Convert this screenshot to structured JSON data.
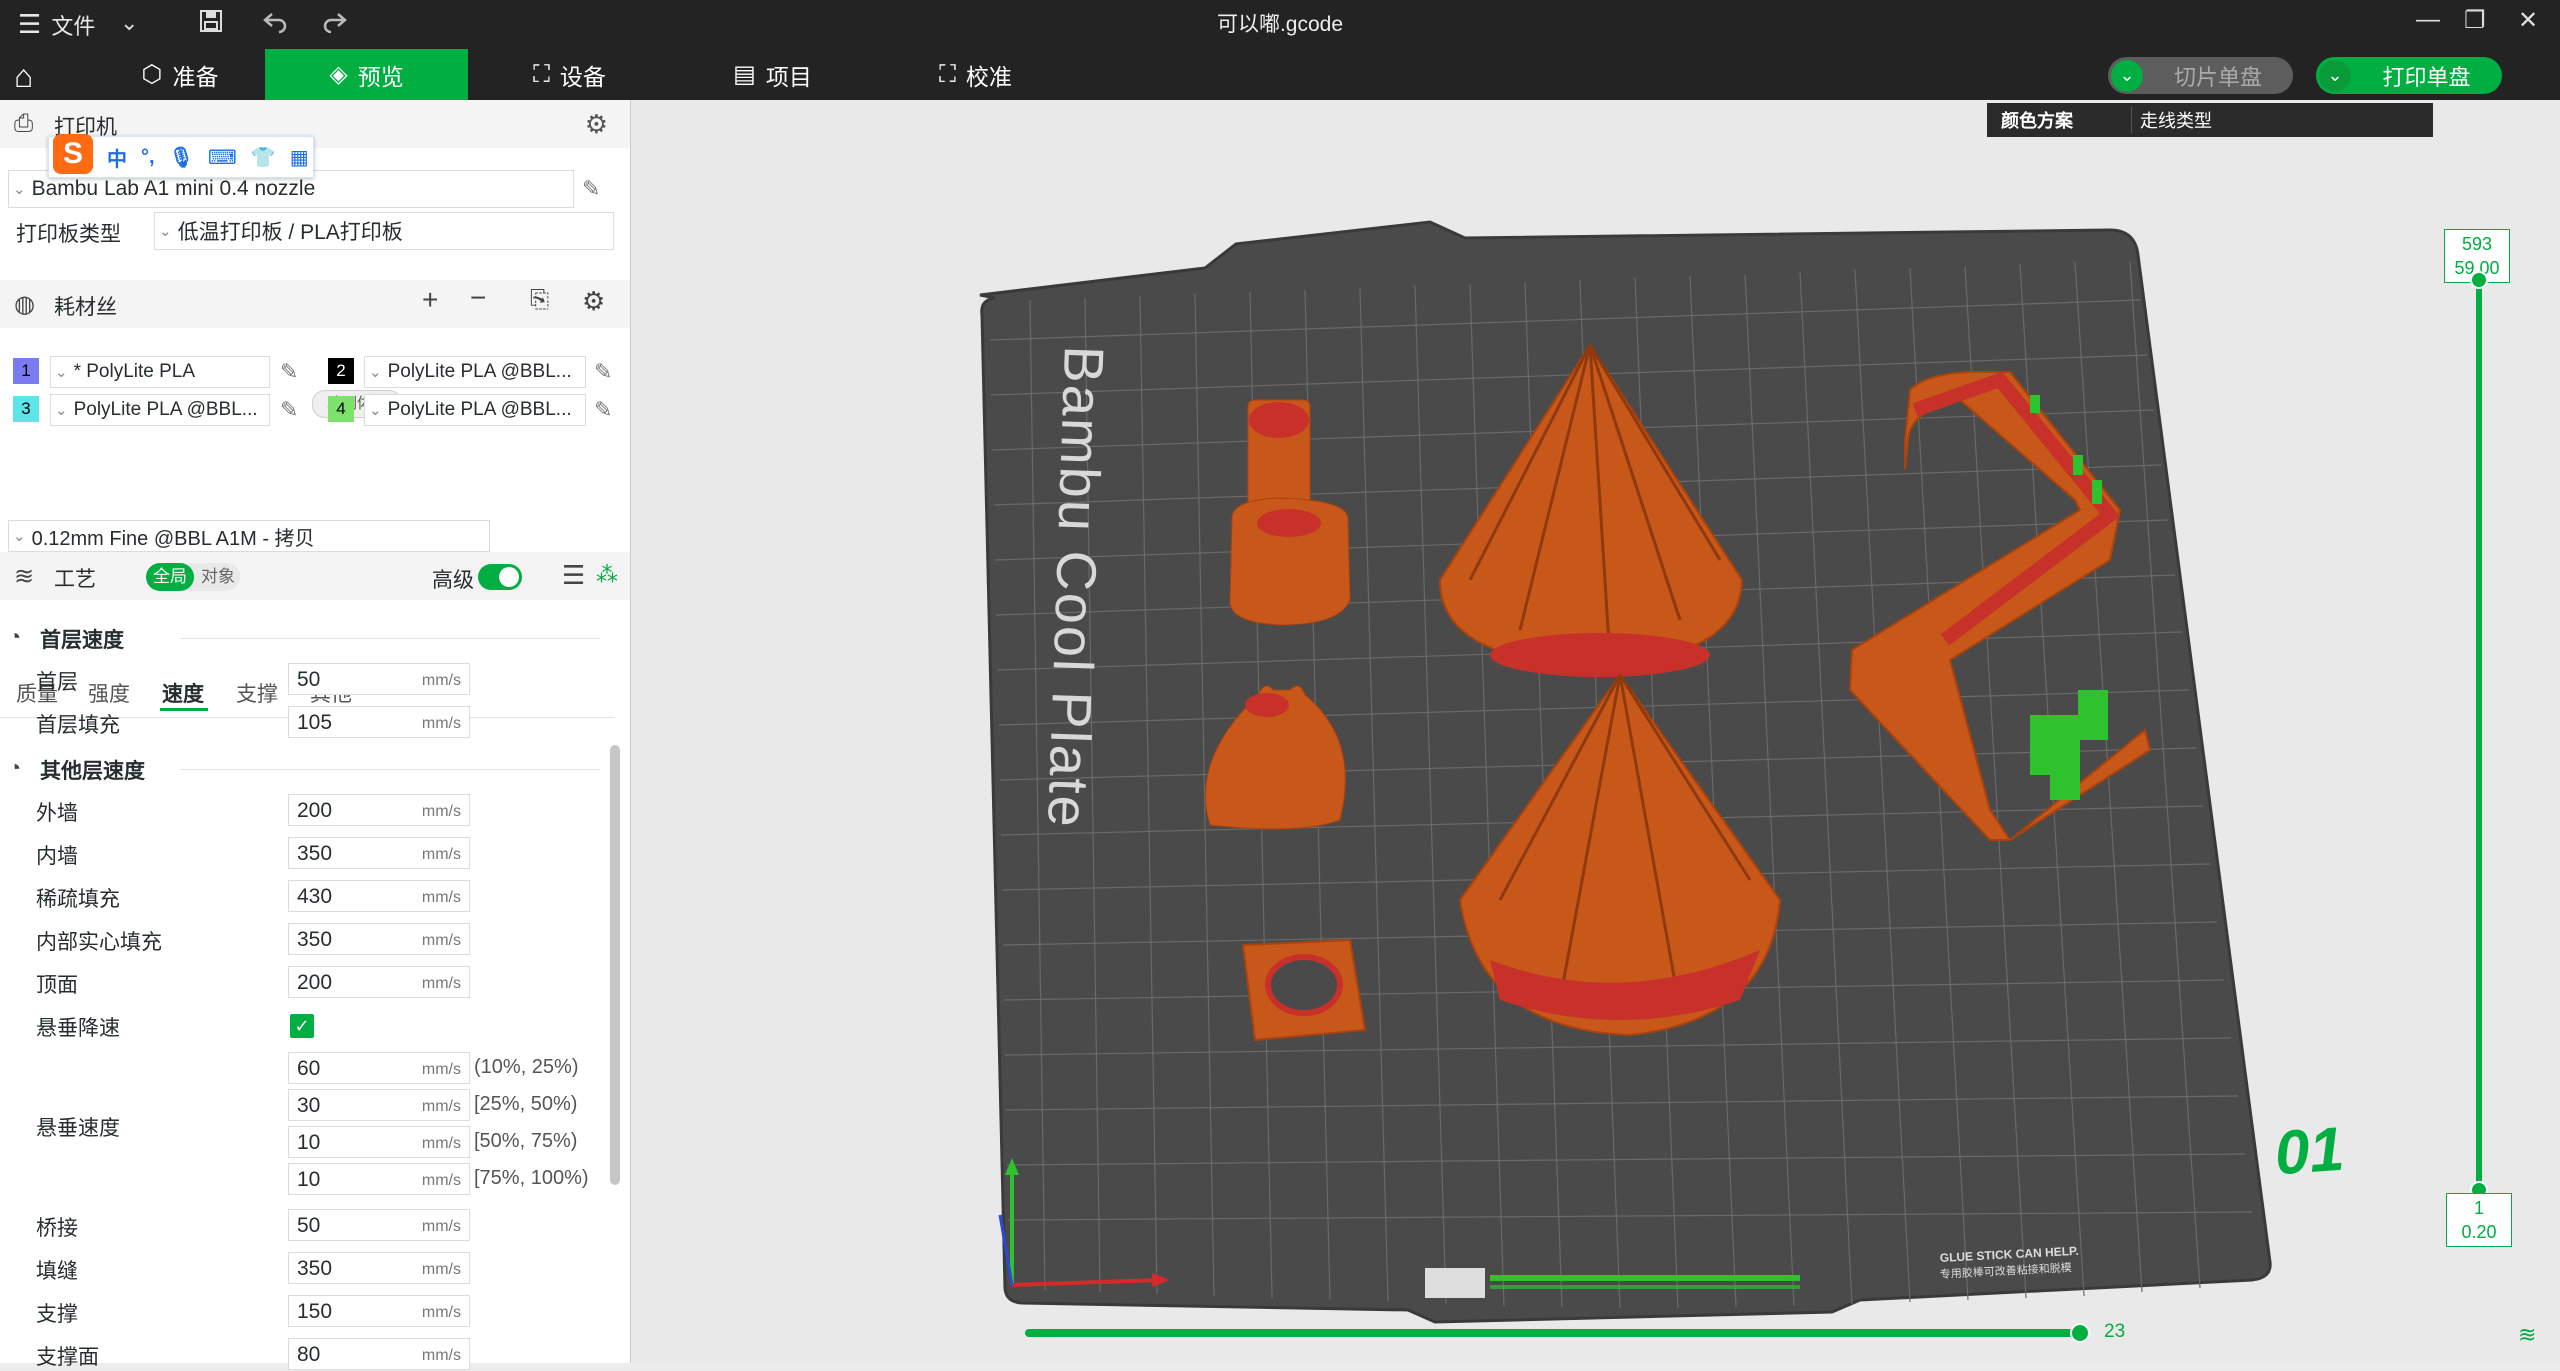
{
  "titlebar": {
    "file_menu": "文件",
    "title": "可以嘟.gcode",
    "hamburger_icon": "menu-icon",
    "save_icon": "save-icon",
    "undo_icon": "undo-icon",
    "redo_icon": "redo-icon"
  },
  "tabs": [
    {
      "label": "准备",
      "icon": "cube-icon"
    },
    {
      "label": "预览",
      "icon": "layers-icon"
    },
    {
      "label": "设备",
      "icon": "device-icon"
    },
    {
      "label": "项目",
      "icon": "project-icon"
    },
    {
      "label": "校准",
      "icon": "calibrate-icon"
    }
  ],
  "actions": {
    "slice_label": "切片单盘",
    "print_label": "打印单盘"
  },
  "ime": {
    "logo": "S",
    "lang": "中"
  },
  "printer": {
    "section_title": "打印机",
    "model": "Bambu Lab A1 mini 0.4 nozzle",
    "plate_type_label": "打印板类型",
    "plate_type_value": "低温打印板 / PLA打印板"
  },
  "filament": {
    "section_title": "耗材丝",
    "flush_label": "冲刷体积",
    "slots": [
      {
        "index": "1",
        "name": "* PolyLite PLA",
        "color": "#7b7bf0"
      },
      {
        "index": "2",
        "name": "PolyLite PLA @BBL...",
        "color": "#000000"
      },
      {
        "index": "3",
        "name": "PolyLite PLA @BBL...",
        "color": "#5ce6ea"
      },
      {
        "index": "4",
        "name": "PolyLite PLA @BBL...",
        "color": "#7be36a"
      }
    ]
  },
  "process": {
    "section_title": "工艺",
    "toggle_global": "全局",
    "toggle_object": "对象",
    "advanced_label": "高级",
    "preset": "0.12mm Fine @BBL A1M - 拷贝",
    "subtabs": [
      "质量",
      "强度",
      "速度",
      "支撑",
      "其他"
    ],
    "active_subtab": "速度"
  },
  "speed": {
    "first_layer_title": "首层速度",
    "first_layer": [
      {
        "label": "首层",
        "value": "50",
        "unit": "mm/s"
      },
      {
        "label": "首层填充",
        "value": "105",
        "unit": "mm/s"
      }
    ],
    "other_title": "其他层速度",
    "other": [
      {
        "label": "外墙",
        "value": "200",
        "unit": "mm/s"
      },
      {
        "label": "内墙",
        "value": "350",
        "unit": "mm/s"
      },
      {
        "label": "稀疏填充",
        "value": "430",
        "unit": "mm/s"
      },
      {
        "label": "内部实心填充",
        "value": "350",
        "unit": "mm/s"
      },
      {
        "label": "顶面",
        "value": "200",
        "unit": "mm/s"
      }
    ],
    "overhang_slowdown_label": "悬垂降速",
    "overhang_speed_label": "悬垂速度",
    "overhang": [
      {
        "value": "60",
        "unit": "mm/s",
        "range": "(10%, 25%)"
      },
      {
        "value": "30",
        "unit": "mm/s",
        "range": "[25%, 50%)"
      },
      {
        "value": "10",
        "unit": "mm/s",
        "range": "[50%, 75%)"
      },
      {
        "value": "10",
        "unit": "mm/s",
        "range": "[75%, 100%)"
      }
    ],
    "more": [
      {
        "label": "桥接",
        "value": "50",
        "unit": "mm/s"
      },
      {
        "label": "填缝",
        "value": "350",
        "unit": "mm/s"
      },
      {
        "label": "支撑",
        "value": "150",
        "unit": "mm/s"
      },
      {
        "label": "支撑面",
        "value": "80",
        "unit": "mm/s"
      }
    ]
  },
  "viewport": {
    "legend_label": "颜色方案",
    "legend_value": "走线类型",
    "plate_text": "Bambu Cool Plate",
    "plate_number": "01",
    "glue_line1": "GLUE STICK CAN HELP.",
    "glue_line2": "专用胶棒可改善粘接和脱模",
    "top_layer": "593",
    "top_height": "59.00",
    "bottom_layer": "1",
    "bottom_height": "0.20",
    "horizontal_value": "23",
    "top_progress": 1.0,
    "horizontal_progress": 1.0,
    "model_color": "#c8571a",
    "support_color": "#2fc22f",
    "accent": "#00ae42"
  }
}
